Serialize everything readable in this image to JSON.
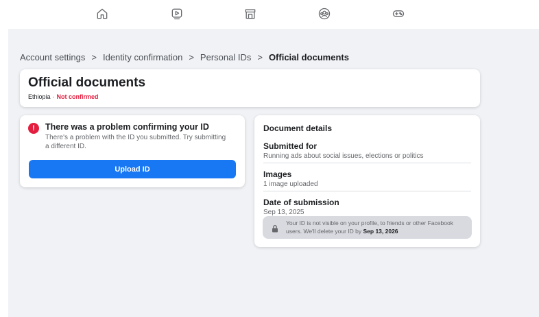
{
  "nav": {
    "items": [
      {
        "icon": "home-icon"
      },
      {
        "icon": "video-icon"
      },
      {
        "icon": "marketplace-icon"
      },
      {
        "icon": "groups-icon"
      },
      {
        "icon": "gaming-icon"
      }
    ]
  },
  "breadcrumb": {
    "items": [
      "Account settings",
      "Identity confirmation",
      "Personal IDs",
      "Official documents"
    ],
    "separator": ">"
  },
  "header": {
    "title": "Official documents",
    "country": "Ethiopia",
    "dot": "·",
    "status": "Not confirmed",
    "status_color": "#e41e3f"
  },
  "problem": {
    "title": "There was a problem confirming your ID",
    "description": "There's a problem with the ID you submitted. Try submitting a different ID.",
    "button_label": "Upload ID",
    "alert_symbol": "!"
  },
  "details": {
    "title": "Document details",
    "rows": [
      {
        "label": "Submitted for",
        "value": "Running ads about social issues, elections or politics"
      },
      {
        "label": "Images",
        "value": "1 image uploaded"
      },
      {
        "label": "Date of submission",
        "value": "Sep 13, 2025"
      }
    ],
    "privacy_text": "Your ID is not visible on your profile, to friends or other Facebook users. We'll delete your ID by",
    "privacy_date": "Sep 13, 2026"
  },
  "colors": {
    "accent": "#1877f2",
    "background": "#f0f2f5"
  }
}
